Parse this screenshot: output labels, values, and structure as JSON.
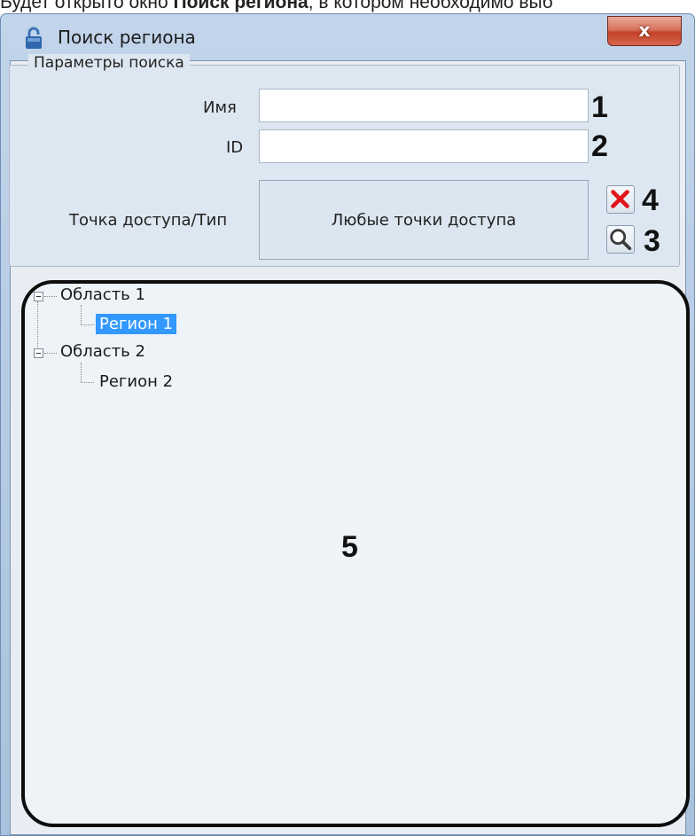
{
  "doc_text": {
    "before": "Будет открыто окно ",
    "bold": "Поиск региона",
    "after": ", в котором необходимо выб"
  },
  "window": {
    "title": "Поиск региона",
    "close_label": "x"
  },
  "search_params": {
    "legend": "Параметры поиска",
    "name_label": "Имя",
    "name_value": "",
    "id_label": "ID",
    "id_value": "",
    "access_label": "Точка доступа/Тип",
    "access_value": "Любые точки доступа"
  },
  "callouts": {
    "name": "1",
    "id": "2",
    "search": "3",
    "clear": "4",
    "tree": "5"
  },
  "tree": {
    "nodes": [
      {
        "label": "Область 1",
        "children": [
          "Регион 1"
        ]
      },
      {
        "label": "Область 2",
        "children": [
          "Регион 2"
        ]
      }
    ],
    "selected": "Регион 1"
  },
  "colors": {
    "selection": "#3399ff",
    "clear_icon": "#e0161b",
    "close_button": "#c5422a"
  }
}
